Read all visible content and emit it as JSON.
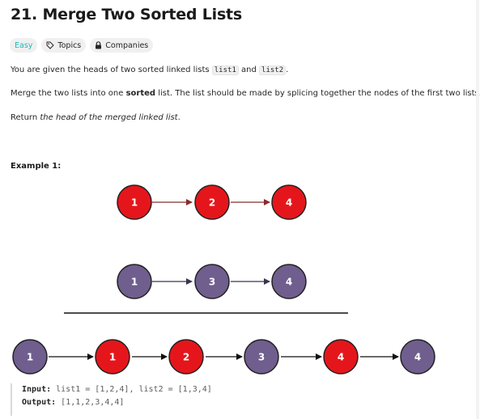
{
  "problem": {
    "title": "21. Merge Two Sorted Lists",
    "tags": {
      "difficulty": "Easy",
      "topics": "Topics",
      "companies": "Companies"
    }
  },
  "description": {
    "p1": {
      "t1": "You are given the heads of two sorted linked lists ",
      "code1": "list1",
      "t2": " and ",
      "code2": "list2",
      "t3": "."
    },
    "p2": {
      "t1": "Merge the two lists into one ",
      "bold": "sorted",
      "t2": " list. The list should be made by splicing together the nodes of the first two lists."
    },
    "p3": {
      "t1": "Return ",
      "italic": "the head of the merged linked list",
      "t2": "."
    }
  },
  "example": {
    "heading": "Example 1:",
    "list1": [
      "1",
      "2",
      "4"
    ],
    "list2": [
      "1",
      "3",
      "4"
    ],
    "merged": [
      "1",
      "1",
      "2",
      "3",
      "4",
      "4"
    ],
    "merged_colors": [
      "purple",
      "red",
      "red",
      "purple",
      "red",
      "purple"
    ],
    "colors": {
      "red": "#e5161b",
      "purple": "#6f5e8e",
      "red_arrow": "#8b2b2b",
      "purple_arrow": "#3c3450",
      "black_arrow": "#111111"
    },
    "input_label": "Input:",
    "input_value": " list1 = [1,2,4], list2 = [1,3,4]",
    "output_label": "Output:",
    "output_value": " [1,1,2,3,4,4]"
  }
}
